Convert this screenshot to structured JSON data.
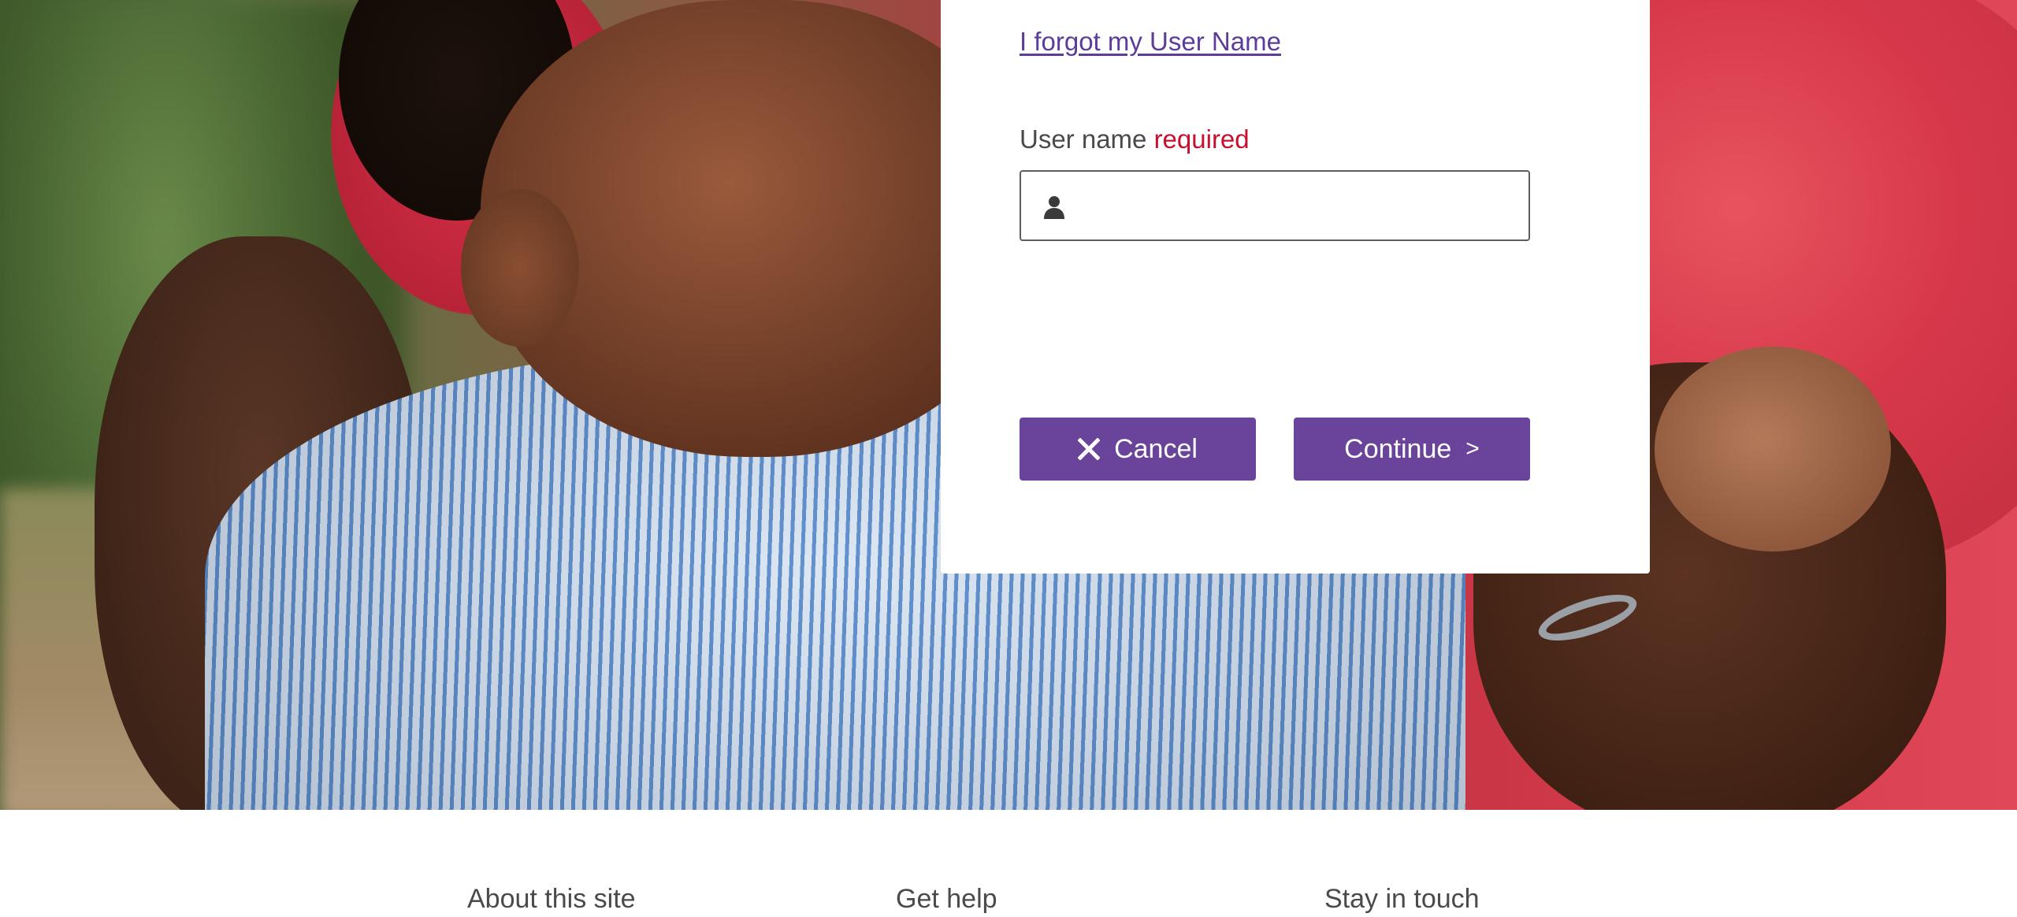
{
  "login": {
    "forgot_link": "I forgot my User Name",
    "username_label": "User name",
    "username_required": "required",
    "username_value": "",
    "username_icon": "user-icon"
  },
  "buttons": {
    "cancel_label": "Cancel",
    "cancel_icon": "close-icon",
    "continue_label": "Continue",
    "continue_icon": ">"
  },
  "footer": {
    "headings": [
      "About this site",
      "Get help",
      "Stay in touch"
    ]
  },
  "colors": {
    "accent": "#6a449a",
    "link": "#5c3d99",
    "required": "#c8102e"
  }
}
